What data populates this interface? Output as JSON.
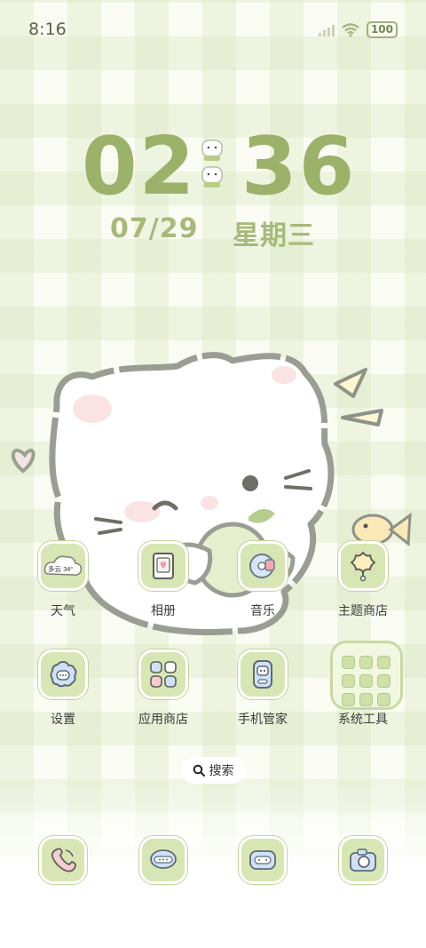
{
  "status_bar": {
    "time": "8:16",
    "battery": "100"
  },
  "clock": {
    "hour": "02",
    "minute": "36",
    "date": "07/29",
    "weekday": "星期三"
  },
  "apps_row1": [
    {
      "label": "天气",
      "icon": "weather-icon",
      "icon_text": "多云 34°"
    },
    {
      "label": "相册",
      "icon": "gallery-icon"
    },
    {
      "label": "音乐",
      "icon": "music-icon"
    },
    {
      "label": "主题商店",
      "icon": "theme-store-icon"
    }
  ],
  "apps_row2": [
    {
      "label": "设置",
      "icon": "settings-icon"
    },
    {
      "label": "应用商店",
      "icon": "app-store-icon"
    },
    {
      "label": "手机管家",
      "icon": "phone-manager-icon"
    },
    {
      "label": "系统工具",
      "icon": "folder-icon"
    }
  ],
  "search": {
    "label": "搜索"
  },
  "dock": [
    {
      "icon": "phone-icon"
    },
    {
      "icon": "messages-icon"
    },
    {
      "icon": "browser-icon"
    },
    {
      "icon": "camera-icon"
    }
  ],
  "colors": {
    "accent": "#9cb16a",
    "tile": "#d7e6b4",
    "bg": "#fafcf3"
  }
}
